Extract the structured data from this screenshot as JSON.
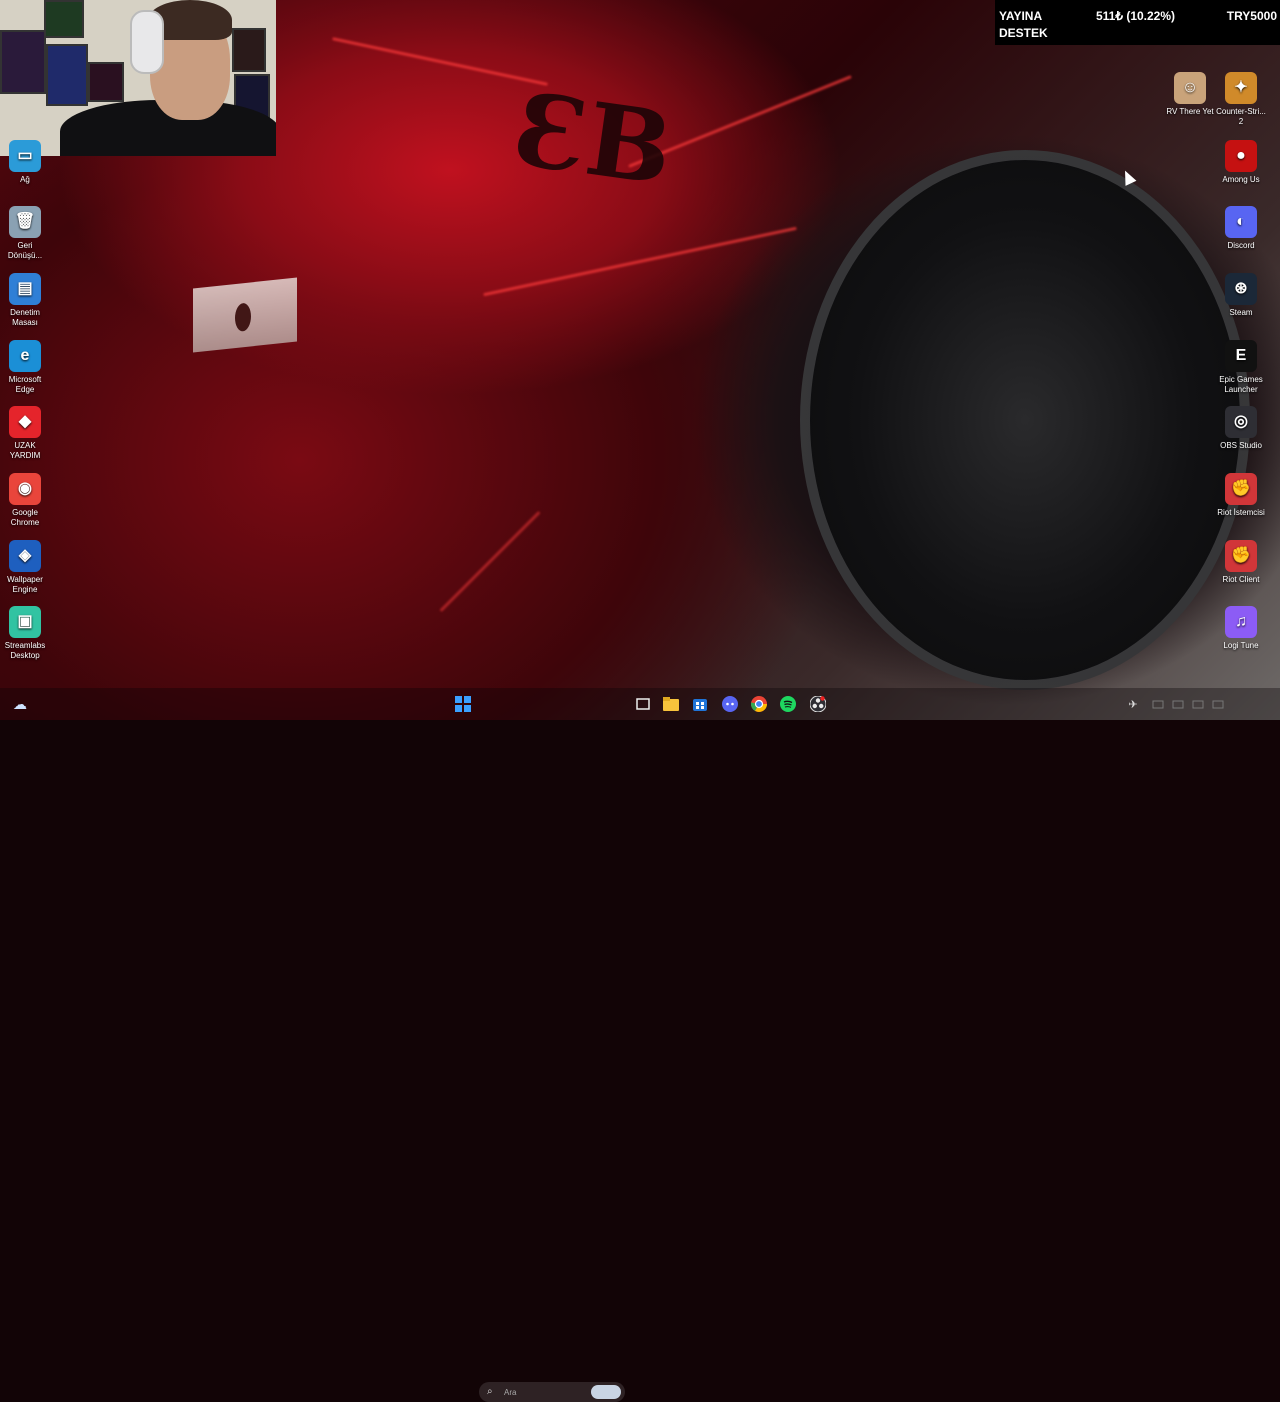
{
  "overlay": {
    "line1": "YAYINA",
    "line2": "DESTEK",
    "amount": "511₺ (10.22%)",
    "target": "TRY5000"
  },
  "left_icons": [
    {
      "label": "Ağ",
      "icon": "network-icon",
      "color": "#2b9bd8"
    },
    {
      "label": "Geri\nDönüşü...",
      "icon": "recycle-bin-icon",
      "color": "#8aa1b3"
    },
    {
      "label": "Denetim\nMasası",
      "icon": "control-panel-icon",
      "color": "#2f7fd6"
    },
    {
      "label": "Microsoft\nEdge",
      "icon": "edge-icon",
      "color": "#1b8fd6"
    },
    {
      "label": "UZAK\nYARDIM",
      "icon": "remote-help-icon",
      "color": "#e5242b"
    },
    {
      "label": "Google\nChrome",
      "icon": "chrome-icon",
      "color": "#e9453b"
    },
    {
      "label": "Wallpaper\nEngine",
      "icon": "wallpaper-engine-icon",
      "color": "#1e5fbf"
    },
    {
      "label": "Streamlabs\nDesktop",
      "icon": "streamlabs-icon",
      "color": "#31c3a2"
    }
  ],
  "right_icons": [
    {
      "label": "RV There Yet",
      "icon": "rv-there-yet-icon",
      "color": "#c9a37a"
    },
    {
      "label": "Counter-Stri...\n2",
      "icon": "counter-strike-icon",
      "color": "#d08a2a"
    },
    {
      "label": "Among Us",
      "icon": "among-us-icon",
      "color": "#c51111"
    },
    {
      "label": "Discord",
      "icon": "discord-icon",
      "color": "#5865f2"
    },
    {
      "label": "Steam",
      "icon": "steam-icon",
      "color": "#1b2838"
    },
    {
      "label": "Epic Games\nLauncher",
      "icon": "epic-games-icon",
      "color": "#111111"
    },
    {
      "label": "OBS Studio",
      "icon": "obs-icon",
      "color": "#2e2e34"
    },
    {
      "label": "Riot İstemcisi",
      "icon": "riot-client-icon",
      "color": "#d13639"
    },
    {
      "label": "Riot Client",
      "icon": "riot-client-icon",
      "color": "#d13639"
    },
    {
      "label": "Logi Tune",
      "icon": "logi-tune-icon",
      "color": "#8c5cf5"
    }
  ],
  "taskbar": {
    "search_placeholder": "Ara",
    "apps": [
      "start-icon",
      "task-view-icon",
      "file-explorer-icon",
      "store-icon",
      "discord-icon",
      "chrome-icon",
      "spotify-icon",
      "obs-icon"
    ]
  }
}
